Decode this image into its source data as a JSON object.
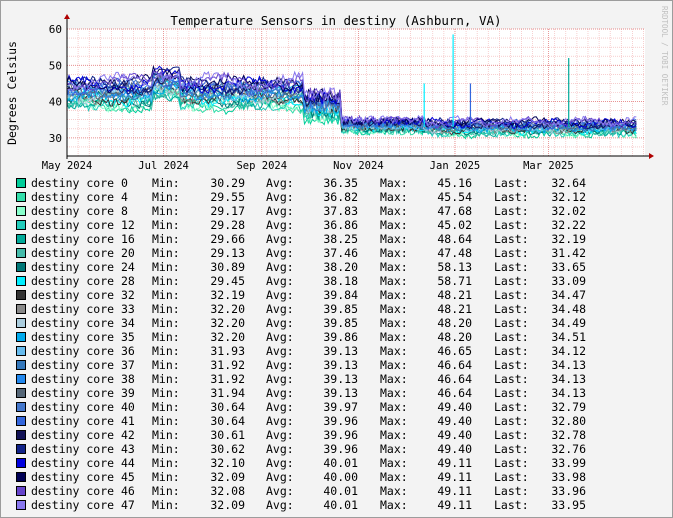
{
  "chart_data": {
    "type": "line",
    "title": "Temperature Sensors in destiny (Ashburn, VA)",
    "ylabel": "Degrees Celsius",
    "watermark": "RRDTOOL / TOBI OETIKER",
    "ylim": [
      25,
      60
    ],
    "yticks": [
      30,
      40,
      50,
      60
    ],
    "xlim": [
      "2024-05-01",
      "2025-05-01"
    ],
    "xticks": [
      {
        "date": "2024-05-01",
        "label": "May 2024"
      },
      {
        "date": "2024-07-01",
        "label": "Jul 2024"
      },
      {
        "date": "2024-09-01",
        "label": "Sep 2024"
      },
      {
        "date": "2024-11-01",
        "label": "Nov 2024"
      },
      {
        "date": "2025-01-01",
        "label": "Jan 2025"
      },
      {
        "date": "2025-03-01",
        "label": "Mar 2025"
      }
    ],
    "grid": true,
    "legend_labels": {
      "min": "Min:",
      "avg": "Avg:",
      "max": "Max:",
      "last": "Last:"
    },
    "series": [
      {
        "name": "destiny core 0",
        "color": "#00cc99",
        "min": "30.29",
        "avg": "36.35",
        "max": "45.16",
        "last": "32.64"
      },
      {
        "name": "destiny core 4",
        "color": "#33ddaa",
        "min": "29.55",
        "avg": "36.82",
        "max": "45.54",
        "last": "32.12"
      },
      {
        "name": "destiny core 8",
        "color": "#88ffcc",
        "min": "29.17",
        "avg": "37.83",
        "max": "47.68",
        "last": "32.02"
      },
      {
        "name": "destiny core 12",
        "color": "#22ccbb",
        "min": "29.28",
        "avg": "36.86",
        "max": "45.02",
        "last": "32.22"
      },
      {
        "name": "destiny core 16",
        "color": "#00aa99",
        "min": "29.66",
        "avg": "38.25",
        "max": "48.64",
        "last": "32.19"
      },
      {
        "name": "destiny core 20",
        "color": "#44bbaa",
        "min": "29.13",
        "avg": "37.46",
        "max": "47.48",
        "last": "31.42"
      },
      {
        "name": "destiny core 24",
        "color": "#007777",
        "min": "30.89",
        "avg": "38.20",
        "max": "58.13",
        "last": "33.65"
      },
      {
        "name": "destiny core 28",
        "color": "#00eeff",
        "min": "29.45",
        "avg": "38.18",
        "max": "58.71",
        "last": "33.09"
      },
      {
        "name": "destiny core 32",
        "color": "#333333",
        "min": "32.19",
        "avg": "39.84",
        "max": "48.21",
        "last": "34.47"
      },
      {
        "name": "destiny core 33",
        "color": "#888888",
        "min": "32.20",
        "avg": "39.85",
        "max": "48.21",
        "last": "34.48"
      },
      {
        "name": "destiny core 34",
        "color": "#aaccdd",
        "min": "32.20",
        "avg": "39.85",
        "max": "48.20",
        "last": "34.49"
      },
      {
        "name": "destiny core 35",
        "color": "#00aaee",
        "min": "32.20",
        "avg": "39.86",
        "max": "48.20",
        "last": "34.51"
      },
      {
        "name": "destiny core 36",
        "color": "#66bbee",
        "min": "31.93",
        "avg": "39.13",
        "max": "46.65",
        "last": "34.12"
      },
      {
        "name": "destiny core 37",
        "color": "#3377bb",
        "min": "31.92",
        "avg": "39.13",
        "max": "46.64",
        "last": "34.13"
      },
      {
        "name": "destiny core 38",
        "color": "#2288ee",
        "min": "31.92",
        "avg": "39.13",
        "max": "46.64",
        "last": "34.13"
      },
      {
        "name": "destiny core 39",
        "color": "#556677",
        "min": "31.94",
        "avg": "39.13",
        "max": "46.64",
        "last": "34.13"
      },
      {
        "name": "destiny core 40",
        "color": "#4477cc",
        "min": "30.64",
        "avg": "39.97",
        "max": "49.40",
        "last": "32.79"
      },
      {
        "name": "destiny core 41",
        "color": "#3366dd",
        "min": "30.64",
        "avg": "39.96",
        "max": "49.40",
        "last": "32.80"
      },
      {
        "name": "destiny core 42",
        "color": "#111155",
        "min": "30.61",
        "avg": "39.96",
        "max": "49.40",
        "last": "32.78"
      },
      {
        "name": "destiny core 43",
        "color": "#112288",
        "min": "30.62",
        "avg": "39.96",
        "max": "49.40",
        "last": "32.76"
      },
      {
        "name": "destiny core 44",
        "color": "#0000dd",
        "min": "32.10",
        "avg": "40.01",
        "max": "49.11",
        "last": "33.99"
      },
      {
        "name": "destiny core 45",
        "color": "#000055",
        "min": "32.09",
        "avg": "40.00",
        "max": "49.11",
        "last": "33.98"
      },
      {
        "name": "destiny core 46",
        "color": "#6644cc",
        "min": "32.08",
        "avg": "40.01",
        "max": "49.11",
        "last": "33.96"
      },
      {
        "name": "destiny core 47",
        "color": "#8877ee",
        "min": "32.09",
        "avg": "40.01",
        "max": "49.11",
        "last": "33.95"
      }
    ]
  }
}
